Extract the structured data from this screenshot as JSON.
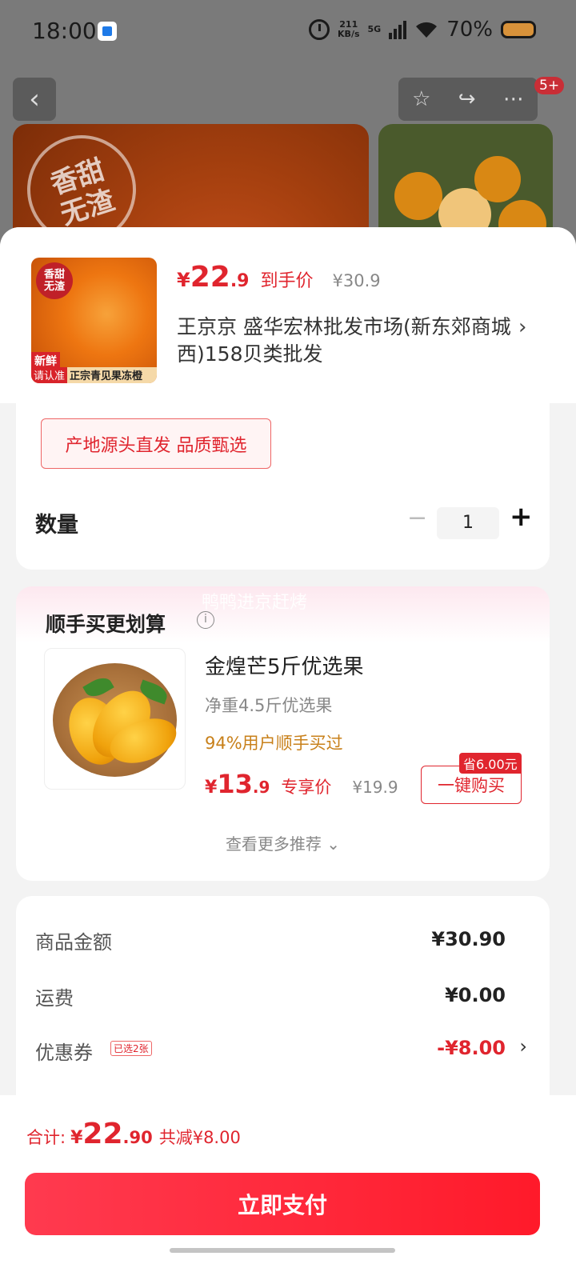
{
  "status_bar": {
    "time": "18:00",
    "net_speed_value": "211",
    "net_speed_unit": "KB/s",
    "network": "5G",
    "battery": "70%"
  },
  "nav": {
    "badge": "5+"
  },
  "hero": {
    "stamp_line1": "香甜",
    "stamp_line2": "无渣"
  },
  "product": {
    "thumb_stamp_line1": "香甜",
    "thumb_stamp_line2": "无渣",
    "thumb_fresh": "新鲜",
    "thumb_bar_red": "请认准",
    "thumb_bar_text": "正宗青见果冻橙",
    "price_yen": "¥",
    "price_int": "22",
    "price_dec": ".9",
    "price_label": "到手价",
    "original_price": "¥30.9",
    "store_name": "王京京  盛华宏林批发市场(新东郊商城西)158贝类批发"
  },
  "options": {
    "tag": "产地源头直发 品质甄选",
    "quantity_label": "数量",
    "quantity_value": "1",
    "minus": "−",
    "plus": "+"
  },
  "recommend": {
    "watermark": "鸭鸭进京赶烤",
    "title": "顺手买更划算",
    "item_name": "金煌芒5斤优选果",
    "item_desc": "净重4.5斤优选果",
    "popularity": "94%用户顺手买过",
    "price_yen": "¥",
    "price_int": "13",
    "price_dec": ".9",
    "price_label": "专享价",
    "original_price": "¥19.9",
    "save_badge": "省6.00元",
    "buy_button": "一键购买",
    "more": "查看更多推荐 ⌄"
  },
  "summary": {
    "goods_label": "商品金额",
    "goods_value": "¥30.90",
    "shipping_label": "运费",
    "shipping_value": "¥0.00",
    "coupon_label": "优惠券",
    "coupon_tag": "已选2张",
    "coupon_value": "-¥8.00"
  },
  "footer": {
    "total_label": "合计:",
    "total_yen": "¥",
    "total_int": "22",
    "total_dec": ".90",
    "saved": "共减¥8.00",
    "pay_button": "立即支付"
  },
  "colors": {
    "accent": "#e0252e",
    "pay_gradient_start": "#ff3a4f",
    "pay_gradient_end": "#ff1a2a"
  }
}
